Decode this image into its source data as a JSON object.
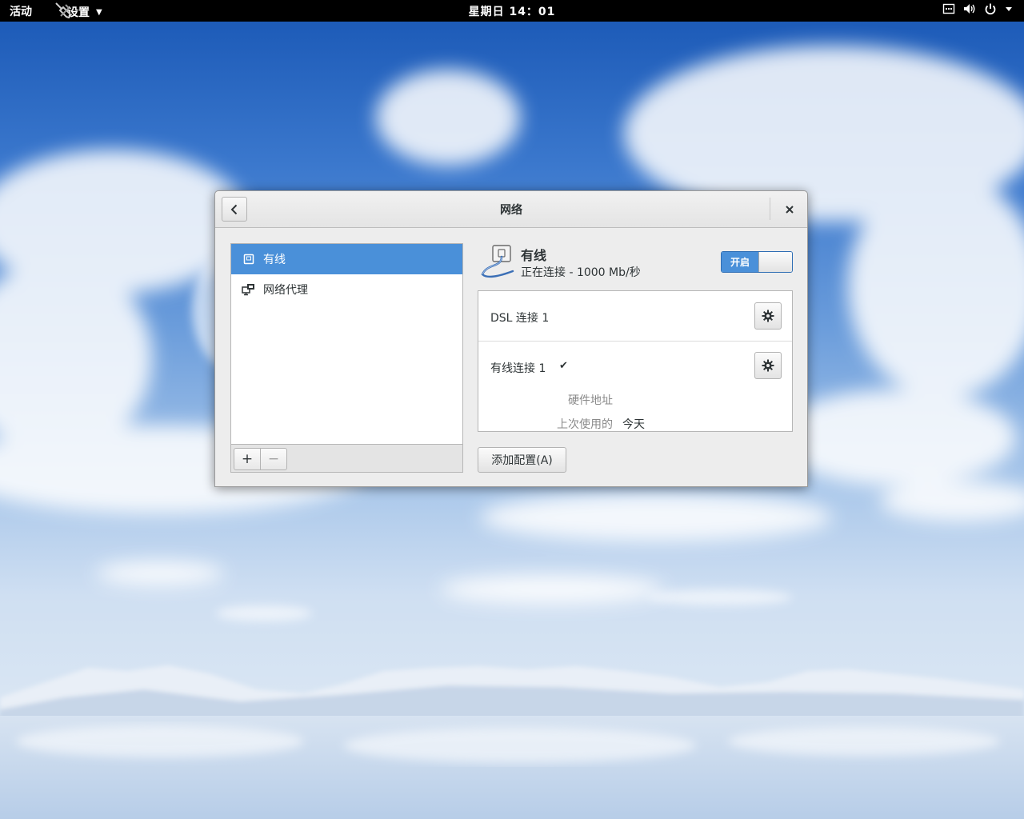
{
  "topbar": {
    "activities": "活动",
    "app_name": "设置",
    "clock": "星期日 14：01",
    "tray_icons": [
      "network-wired-icon",
      "volume-icon",
      "power-icon",
      "chevron-down-icon"
    ]
  },
  "window": {
    "title": "网络",
    "back_icon": "chevron-left-icon",
    "close_icon": "close-icon"
  },
  "devices": {
    "items": [
      {
        "label": "有线",
        "icon": "network-wired-icon",
        "selected": true
      },
      {
        "label": "网络代理",
        "icon": "network-proxy-icon",
        "selected": false
      }
    ],
    "add_label": "+",
    "remove_label": "−"
  },
  "device_detail": {
    "name": "有线",
    "status": "正在连接 - 1000 Mb/秒",
    "switch_label": "开启",
    "switch_on": true
  },
  "profiles": [
    {
      "name": "DSL 连接 1",
      "active": false
    },
    {
      "name": "有线连接 1",
      "active": true,
      "check": "✔",
      "hardware_address_label": "硬件地址",
      "last_used_label": "上次使用的",
      "last_used_value": "今天"
    }
  ],
  "add_profile_label": "添加配置(A)",
  "colors": {
    "accent": "#4a90d9",
    "topbar": "#000000",
    "window_bg": "#ededed"
  }
}
